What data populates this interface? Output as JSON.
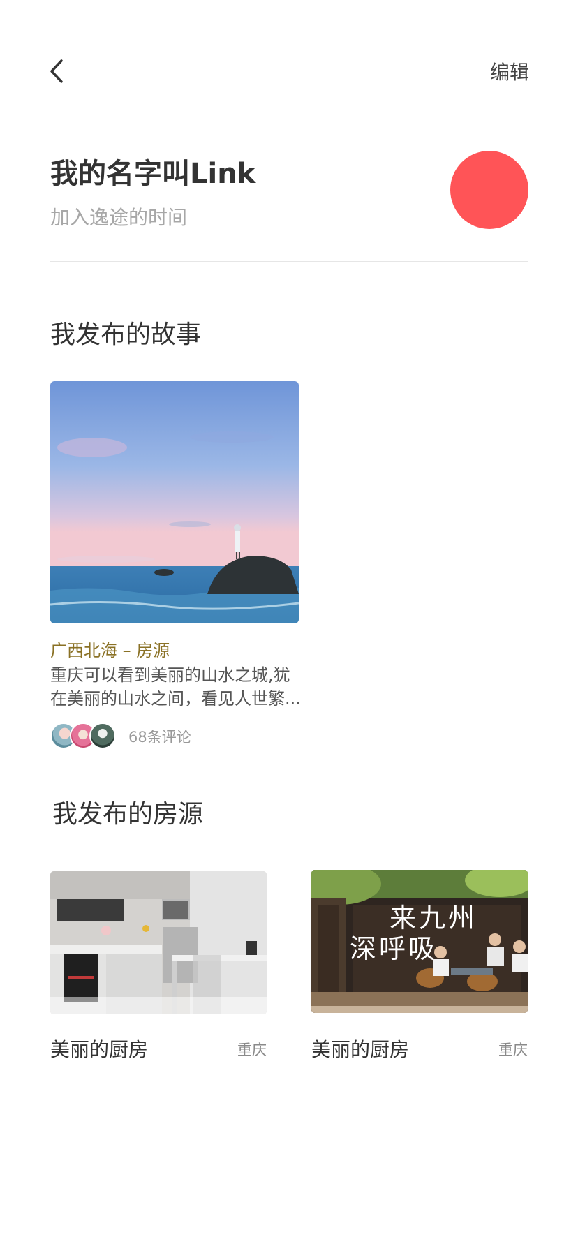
{
  "header": {
    "back_icon": "chevron-left-icon",
    "edit_label": "编辑"
  },
  "profile": {
    "name": "我的名字叫Link",
    "subtitle": "加入逸途的时间",
    "avatar_color": "#ff5457"
  },
  "stories": {
    "section_title": "我发布的故事",
    "items": [
      {
        "location": "广西北海 – 房源",
        "description_lines": [
          "重庆可以看到美丽的山水之城,犹",
          "在美丽的山水之间，看见人世繁..."
        ],
        "comment_count": "68条评论",
        "location_color": "#8a7125"
      }
    ]
  },
  "houses": {
    "section_title": "我发布的房源",
    "items": [
      {
        "title": "美丽的厨房",
        "city": "重庆"
      },
      {
        "title": "美丽的厨房",
        "city": "重庆",
        "image_text_line1": "来九州",
        "image_text_line2": "深呼吸"
      }
    ]
  }
}
